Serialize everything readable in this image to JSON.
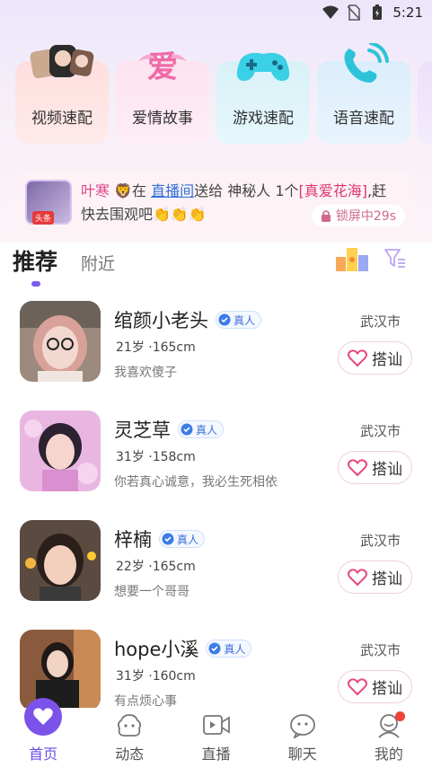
{
  "status_bar": {
    "time": "5:21"
  },
  "features": [
    {
      "label": "视频速配",
      "icon": "video-match-icon"
    },
    {
      "label": "爱情故事",
      "icon": "love-story-icon",
      "art_text": "爱"
    },
    {
      "label": "游戏速配",
      "icon": "gamepad-icon"
    },
    {
      "label": "语音速配",
      "icon": "phone-call-icon"
    }
  ],
  "notice": {
    "avatar_badge": "头条",
    "name": "叶寒",
    "emoji": "🦁",
    "at": "在",
    "room": "直播间",
    "sent": "送给 神秘人 1个",
    "gift": "[真爱花海]",
    "tail": ",赶",
    "line2": "快去围观吧👏👏👏",
    "lock_text": "锁屏中29s"
  },
  "tabs": {
    "active": "推荐",
    "other": "附近"
  },
  "users": [
    {
      "name": "绾颜小老头",
      "verified": "真人",
      "meta": "21岁 ·165cm",
      "bio": "我喜欢傻子",
      "city": "武汉市",
      "action": "搭讪"
    },
    {
      "name": "灵芝草",
      "verified": "真人",
      "meta": "31岁 ·158cm",
      "bio": "你若真心诚意，我必生死相依",
      "city": "武汉市",
      "action": "搭讪"
    },
    {
      "name": "梓楠",
      "verified": "真人",
      "meta": "22岁 ·165cm",
      "bio": "想要一个哥哥",
      "city": "武汉市",
      "action": "搭讪"
    },
    {
      "name": "hope小溪",
      "verified": "真人",
      "meta": "31岁 ·160cm",
      "bio": "有点烦心事",
      "city": "武汉市",
      "action": "搭讪"
    }
  ],
  "nav": [
    {
      "label": "首页",
      "icon": "home-heart-icon",
      "active": true
    },
    {
      "label": "动态",
      "icon": "moments-icon"
    },
    {
      "label": "直播",
      "icon": "live-icon"
    },
    {
      "label": "聊天",
      "icon": "chat-icon"
    },
    {
      "label": "我的",
      "icon": "profile-icon"
    }
  ],
  "colors": {
    "accent": "#6c4de6",
    "pink": "#e0468a",
    "link": "#2f6fd6"
  }
}
